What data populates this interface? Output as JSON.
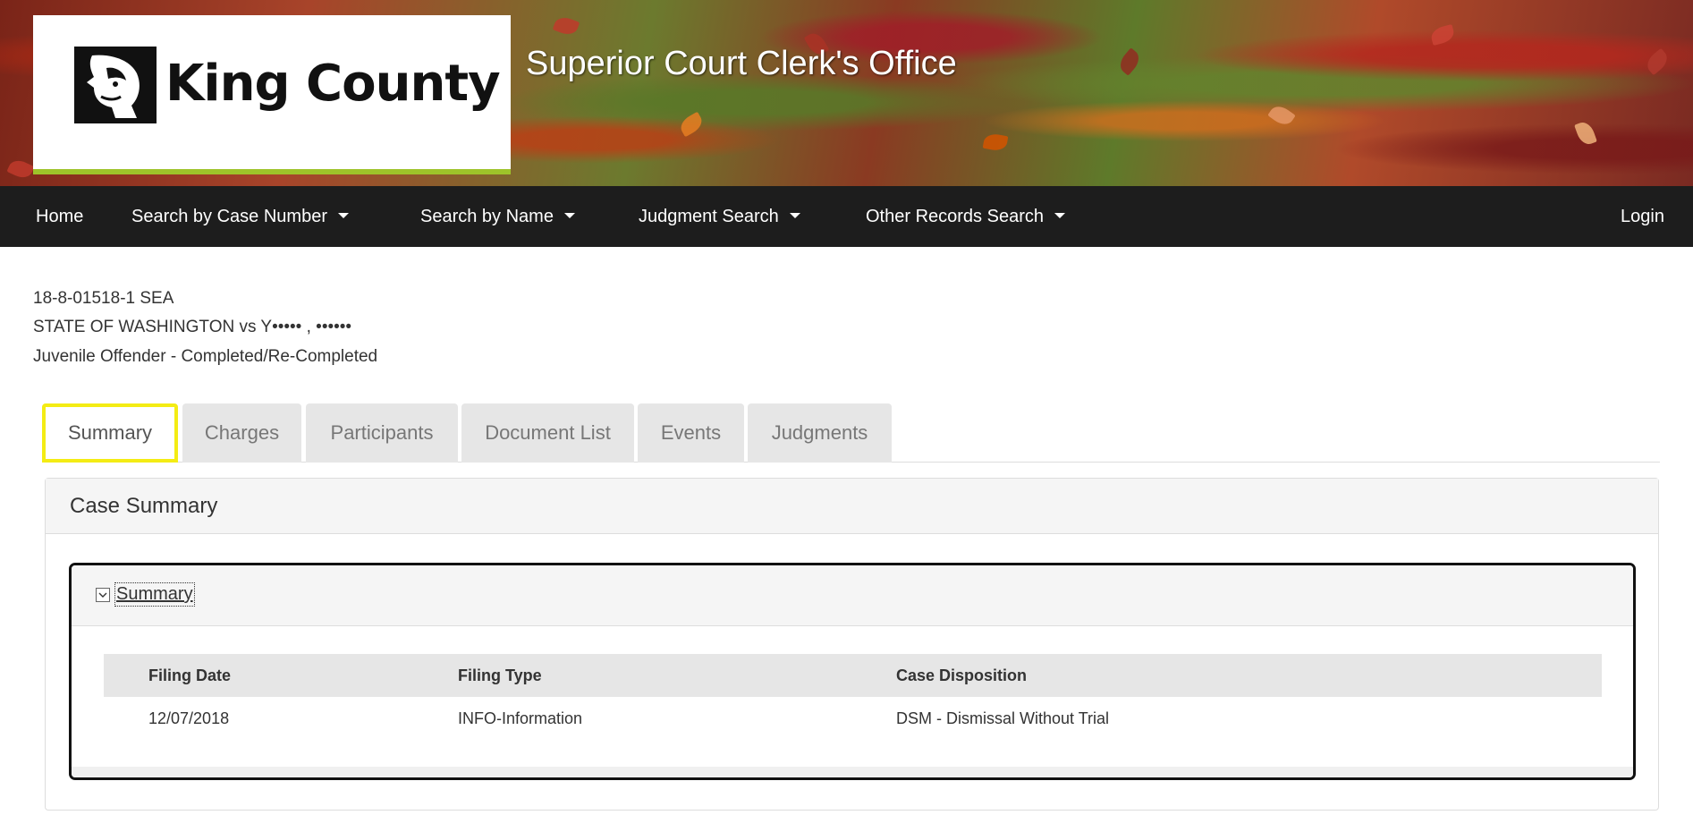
{
  "header": {
    "logo_text": "King County",
    "site_title": "Superior Court Clerk's Office"
  },
  "nav": {
    "home": "Home",
    "search_by_case_number": "Search by Case Number",
    "search_by_name": "Search by Name",
    "judgment_search": "Judgment Search",
    "other_records_search": "Other Records Search",
    "login": "Login"
  },
  "case": {
    "number": "18-8-01518-1 SEA",
    "title": "STATE OF WASHINGTON vs Y•••••  , ••••••",
    "type": "Juvenile Offender - Completed/Re-Completed"
  },
  "tabs": [
    {
      "label": "Summary",
      "active": true
    },
    {
      "label": "Charges",
      "active": false
    },
    {
      "label": "Participants",
      "active": false
    },
    {
      "label": "Document List",
      "active": false
    },
    {
      "label": "Events",
      "active": false
    },
    {
      "label": "Judgments",
      "active": false
    }
  ],
  "panel": {
    "title": "Case Summary",
    "section_title": "Summary",
    "columns": [
      "Filing Date",
      "Filing Type",
      "Case Disposition"
    ],
    "rows": [
      [
        "12/07/2018",
        "INFO-Information",
        "DSM - Dismissal Without Trial"
      ]
    ]
  },
  "colors": {
    "nav_bg": "#1d1d1d",
    "active_tab_highlight": "#f4ec14",
    "logo_accent": "#9ec32a"
  }
}
